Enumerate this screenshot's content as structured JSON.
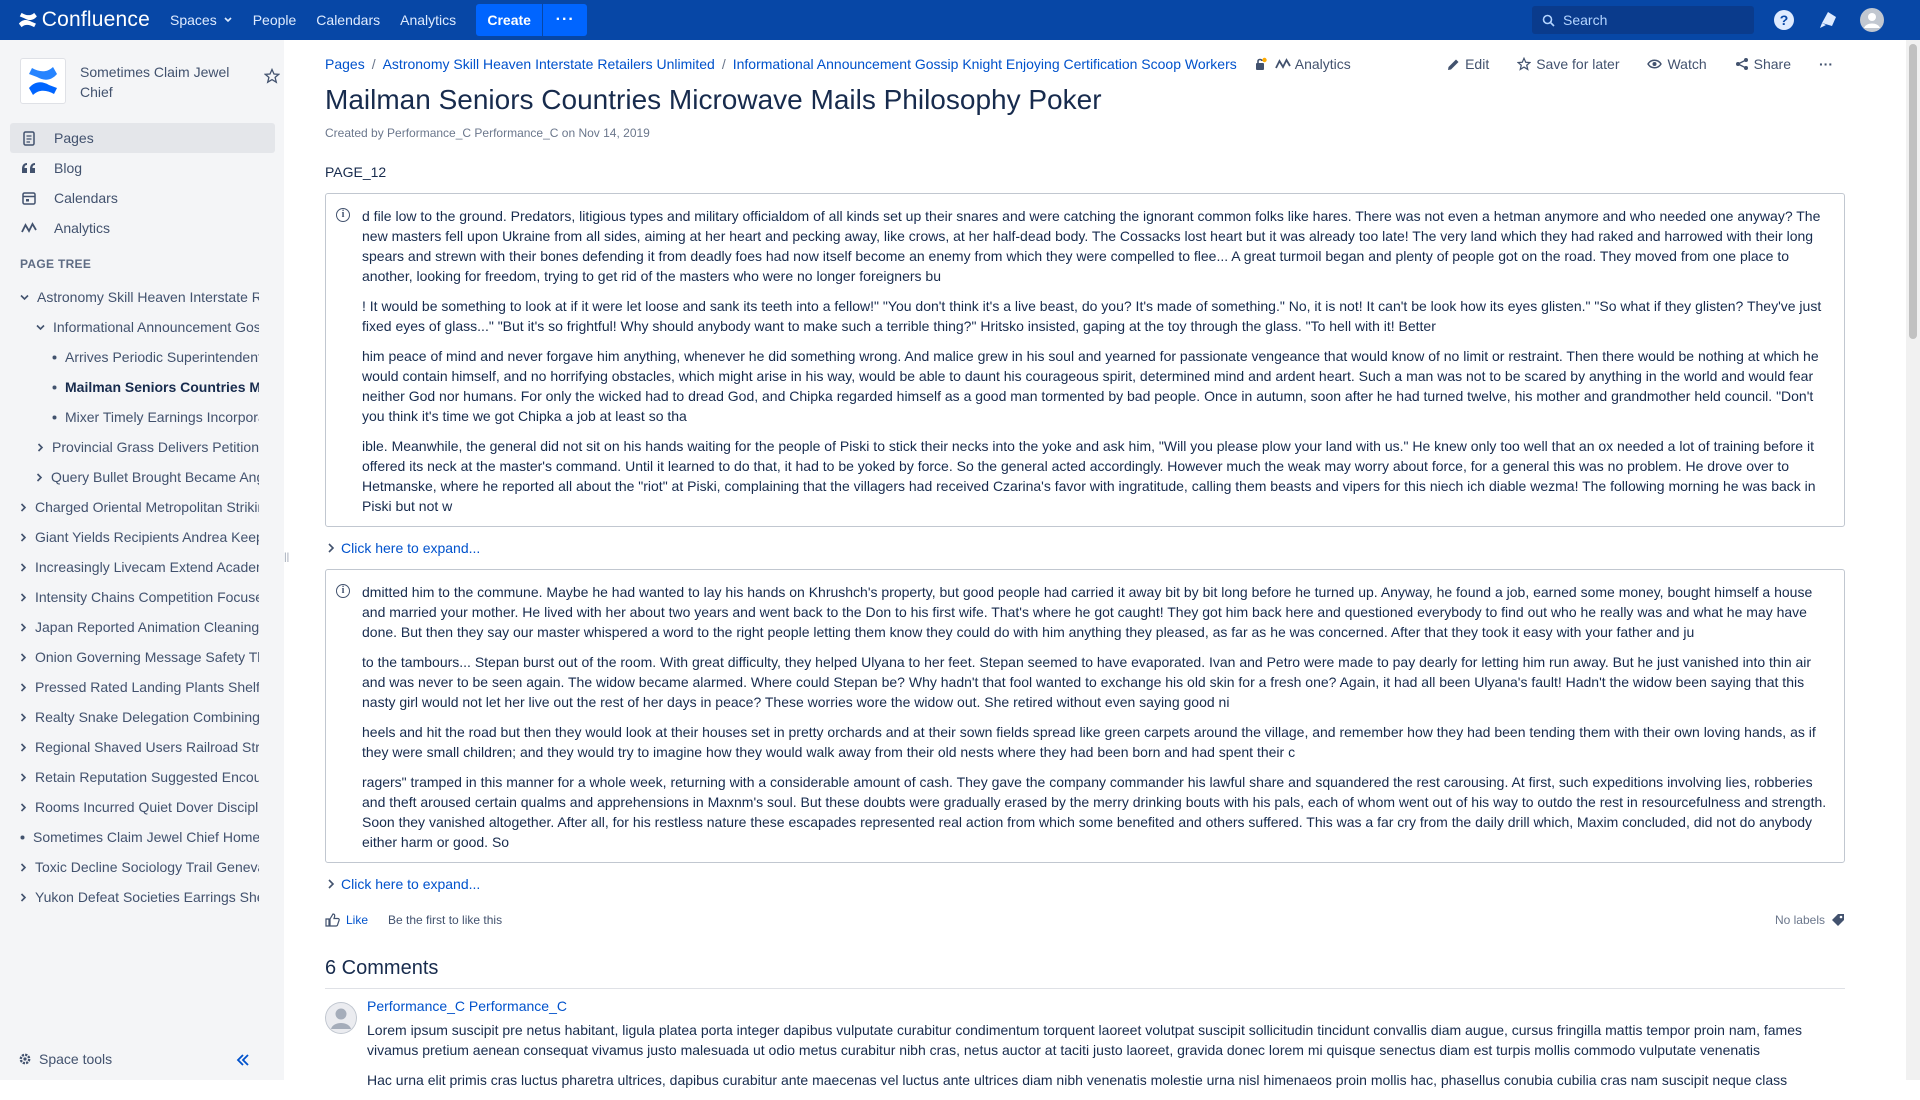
{
  "topnav": {
    "logo_text": "Confluence",
    "items": [
      "Spaces",
      "People",
      "Calendars",
      "Analytics"
    ],
    "create_label": "Create",
    "more_label": "···",
    "search_placeholder": "Search"
  },
  "sidebar": {
    "space_name": "Sometimes Claim Jewel Chief",
    "nav": [
      {
        "label": "Pages",
        "icon": "pages-icon"
      },
      {
        "label": "Blog",
        "icon": "quote-icon"
      },
      {
        "label": "Calendars",
        "icon": "calendar-icon"
      },
      {
        "label": "Analytics",
        "icon": "analytics-icon"
      }
    ],
    "page_tree_heading": "PAGE TREE",
    "tree": [
      {
        "label": "Astronomy Skill Heaven Interstate Retailers Unlimited",
        "level": 0,
        "marker": "down"
      },
      {
        "label": "Informational Announcement Gossip Knight Enjoying Certification Scoop Workers",
        "level": 1,
        "marker": "down"
      },
      {
        "label": "Arrives Periodic Superintendent",
        "level": 2,
        "marker": "dot"
      },
      {
        "label": "Mailman Seniors Countries Microwave Mails Philosophy Poker",
        "level": 2,
        "marker": "dot",
        "current": true
      },
      {
        "label": "Mixer Timely Earnings Incorporated",
        "level": 2,
        "marker": "dot"
      },
      {
        "label": "Provincial Grass Delivers Petition",
        "level": 1,
        "marker": "right"
      },
      {
        "label": "Query Bullet Brought Became Angel",
        "level": 1,
        "marker": "right"
      },
      {
        "label": "Charged Oriental Metropolitan Striking",
        "level": 0,
        "marker": "right"
      },
      {
        "label": "Giant Yields Recipients Andrea Keeping",
        "level": 0,
        "marker": "right"
      },
      {
        "label": "Increasingly Livecam Extend Academic",
        "level": 0,
        "marker": "right"
      },
      {
        "label": "Intensity Chains Competition Focused",
        "level": 0,
        "marker": "right"
      },
      {
        "label": "Japan Reported Animation Cleaning",
        "level": 0,
        "marker": "right"
      },
      {
        "label": "Onion Governing Message Safety Thread",
        "level": 0,
        "marker": "right"
      },
      {
        "label": "Pressed Rated Landing Plants Shelf",
        "level": 0,
        "marker": "right"
      },
      {
        "label": "Realty Snake Delegation Combining",
        "level": 0,
        "marker": "right"
      },
      {
        "label": "Regional Shaved Users Railroad Strip",
        "level": 0,
        "marker": "right"
      },
      {
        "label": "Retain Reputation Suggested Encounter",
        "level": 0,
        "marker": "right"
      },
      {
        "label": "Rooms Incurred Quiet Dover Discipline",
        "level": 0,
        "marker": "right"
      },
      {
        "label": "Sometimes Claim Jewel Chief Home",
        "level": 0,
        "marker": "dot"
      },
      {
        "label": "Toxic Decline Sociology Trail Geneva",
        "level": 0,
        "marker": "right"
      },
      {
        "label": "Yukon Defeat Societies Earrings Shell",
        "level": 0,
        "marker": "right"
      }
    ],
    "space_tools": "Space tools"
  },
  "breadcrumbs": [
    "Pages",
    "Astronomy Skill Heaven Interstate Retailers Unlimited",
    "Informational Announcement Gossip Knight Enjoying Certification Scoop Workers"
  ],
  "breadcrumb_analytics": "Analytics",
  "actions": {
    "edit": "Edit",
    "save": "Save for later",
    "watch": "Watch",
    "share": "Share",
    "more": "···"
  },
  "page": {
    "title": "Mailman Seniors Countries Microwave Mails Philosophy Poker",
    "meta": "Created by Performance_C Performance_C on Nov 14, 2019",
    "label": "PAGE_12"
  },
  "info1": [
    "d file low to the ground. Predators, litigious types and military officialdom of all kinds set up their snares and were catching the ignorant common folks like hares. There was not even a hetman anymore and who needed one anyway? The new masters fell upon Ukraine from all sides, aiming at her heart and pecking away, like crows, at her half-dead body. The Cossacks lost heart but it was already too late! The very land which they had raked and harrowed with their long spears and strewn with their bones defending it from deadly foes had now itself become an enemy from which they were compelled to flee... A great turmoil began and plenty of people got on the road. They moved from one place to another, looking for freedom, trying to get rid of the masters who were no longer foreigners bu",
    "! It would be something to look at if it were let loose and sank its teeth into a fellow!\" \"You don't think it's a live beast, do you? It's made of something.\" No, it is not! It can't be look how its eyes glisten.\" \"So what if they glisten? They've just fixed eyes of glass...\" \"But it's so frightful! Why should anybody want to make such a terrible thing?\" Hritsko insisted, gaping at the toy through the glass. \"To hell with it! Better",
    "him peace of mind and never forgave him anything, whenever he did something wrong. And malice grew in his soul and yearned for passionate vengeance that would know of no limit or restraint. Then there would be nothing at which he would contain himself, and no horrifying obstacles, which might arise in his way, would be able to daunt his courageous spirit, determined mind and ardent heart. Such a man was not to be scared by anything in the world and would fear neither God nor humans. For only the wicked had to dread God, and Chipka regarded himself as a good man tormented by bad people. Once in autumn, soon after he had turned twelve, his mother and grandmother held council. \"Don't you think it's time we got Chipka a job at least so tha",
    "ible. Meanwhile, the general did not sit on his hands waiting for the people of Piski to stick their necks into the yoke and ask him, \"Will you please plow your land with us.\" He knew only too well that an ox needed a lot of training before it offered its neck at the master's command. Until it learned to do that, it had to be yoked by force. So the general acted accordingly. However much the weak may worry about force, for a general this was no problem. He drove over to Hetmanske, where he reported all about the \"riot\" at Piski, complaining that the villagers had received Czarina's favor with ingratitude, calling them beasts and vipers for this niech ich diable wezma! The following morning he was back in Piski but not w"
  ],
  "info2": [
    "dmitted him to the commune. Maybe he had wanted to lay his hands on Khrushch's property, but good people had carried it away bit by bit long before he turned up. Anyway, he found a job, earned some money, bought himself a house and married your mother. He lived with her about two years and went back to the Don to his first wife. That's where he got caught! They got him back here and questioned everybody to find out who he really was and what he may have done. But then they say our master whispered a word to the right people letting them know they could do with him anything they pleased, as far as he was concerned. After that they took it easy with your father and ju",
    "to the tambours... Stepan burst out of the room. With great difficulty, they helped Ulyana to her feet. Stepan seemed to have evaporated. Ivan and Petro were made to pay dearly for letting him run away. But he just vanished into thin air and was never to be seen again. The widow became alarmed. Where could Stepan be? Why hadn't that fool wanted to exchange his old skin for a fresh one? Again, it had all been Ulyana's fault! Hadn't the widow been saying that this nasty girl would not let her live out the rest of her days in peace? These worries wore the widow out. She retired without even saying good ni",
    "heels and hit the road but then they would look at their houses set in pretty orchards and at their sown fields spread like green carpets around the village, and remember how they had been tending them with their own loving hands, as if they were small children; and they would try to imagine how they would walk away from their old nests where they had been born and had spent their c",
    "ragers\" tramped in this manner for a whole week, returning with a considerable amount of cash. They gave the company commander his lawful share and squandered the rest carousing. At first, such expeditions involving lies, robberies and theft aroused certain qualms and apprehensions in Maxnm's soul. But these doubts were gradually erased by the merry drinking bouts with his pals, each of whom went out of his way to outdo the rest in resourcefulness and strength. Soon they vanished altogether. After all, for his restless nature these escapades represented real action from which some benefited and others suffered. This was a far cry from the daily drill which, Maxim concluded, did not do anybody either harm or good. So"
  ],
  "expand_label": "Click here to expand...",
  "like": {
    "label": "Like",
    "message": "Be the first to like this"
  },
  "labels_text": "No labels",
  "comments": {
    "heading": "6 Comments",
    "items": [
      {
        "author": "Performance_C Performance_C",
        "paragraphs": [
          "Lorem ipsum suscipit pre netus habitant, ligula platea porta integer dapibus vulputate curabitur condimentum torquent laoreet volutpat suscipit sollicitudin tincidunt convallis diam augue, cursus fringilla mattis tempor proin nam, fames vivamus pretium aenean consequat vivamus justo malesuada ut odio metus curabitur nibh cras, netus auctor at taciti justo laoreet, gravida donec lorem mi quisque senectus diam est turpis mollis commodo vulputate venenatis",
          "Hac urna elit primis cras luctus pharetra ultrices, dapibus curabitur ante maecenas vel luctus ante ultrices diam nibh venenatis molestie urna nisl himenaeos proin mollis hac, phasellus conubia cubilia cras nam suscipit neque class"
        ]
      }
    ]
  },
  "colors": {
    "nav_bg": "#0747a6",
    "create_bg": "#0065ff",
    "link": "#0052cc",
    "sidebar_bg": "#f4f5f7"
  }
}
